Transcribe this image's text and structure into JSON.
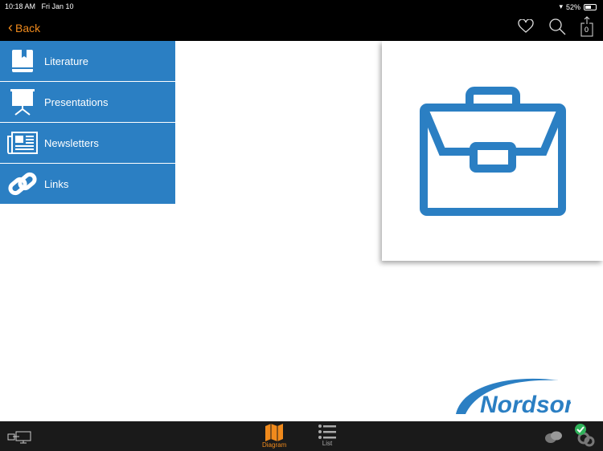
{
  "status": {
    "time": "10:18 AM",
    "date": "Fri Jan 10",
    "battery": "52%"
  },
  "nav": {
    "back_label": "Back",
    "cart_count": "0"
  },
  "menu": [
    {
      "label": "Literature"
    },
    {
      "label": "Presentations"
    },
    {
      "label": "Newsletters"
    },
    {
      "label": "Links"
    }
  ],
  "brand": {
    "logo_text": "Nordson"
  },
  "tabs": [
    {
      "label": "Diagram"
    },
    {
      "label": "List"
    }
  ],
  "colors": {
    "accent": "#f08a1c",
    "blue": "#2b7fc3"
  }
}
